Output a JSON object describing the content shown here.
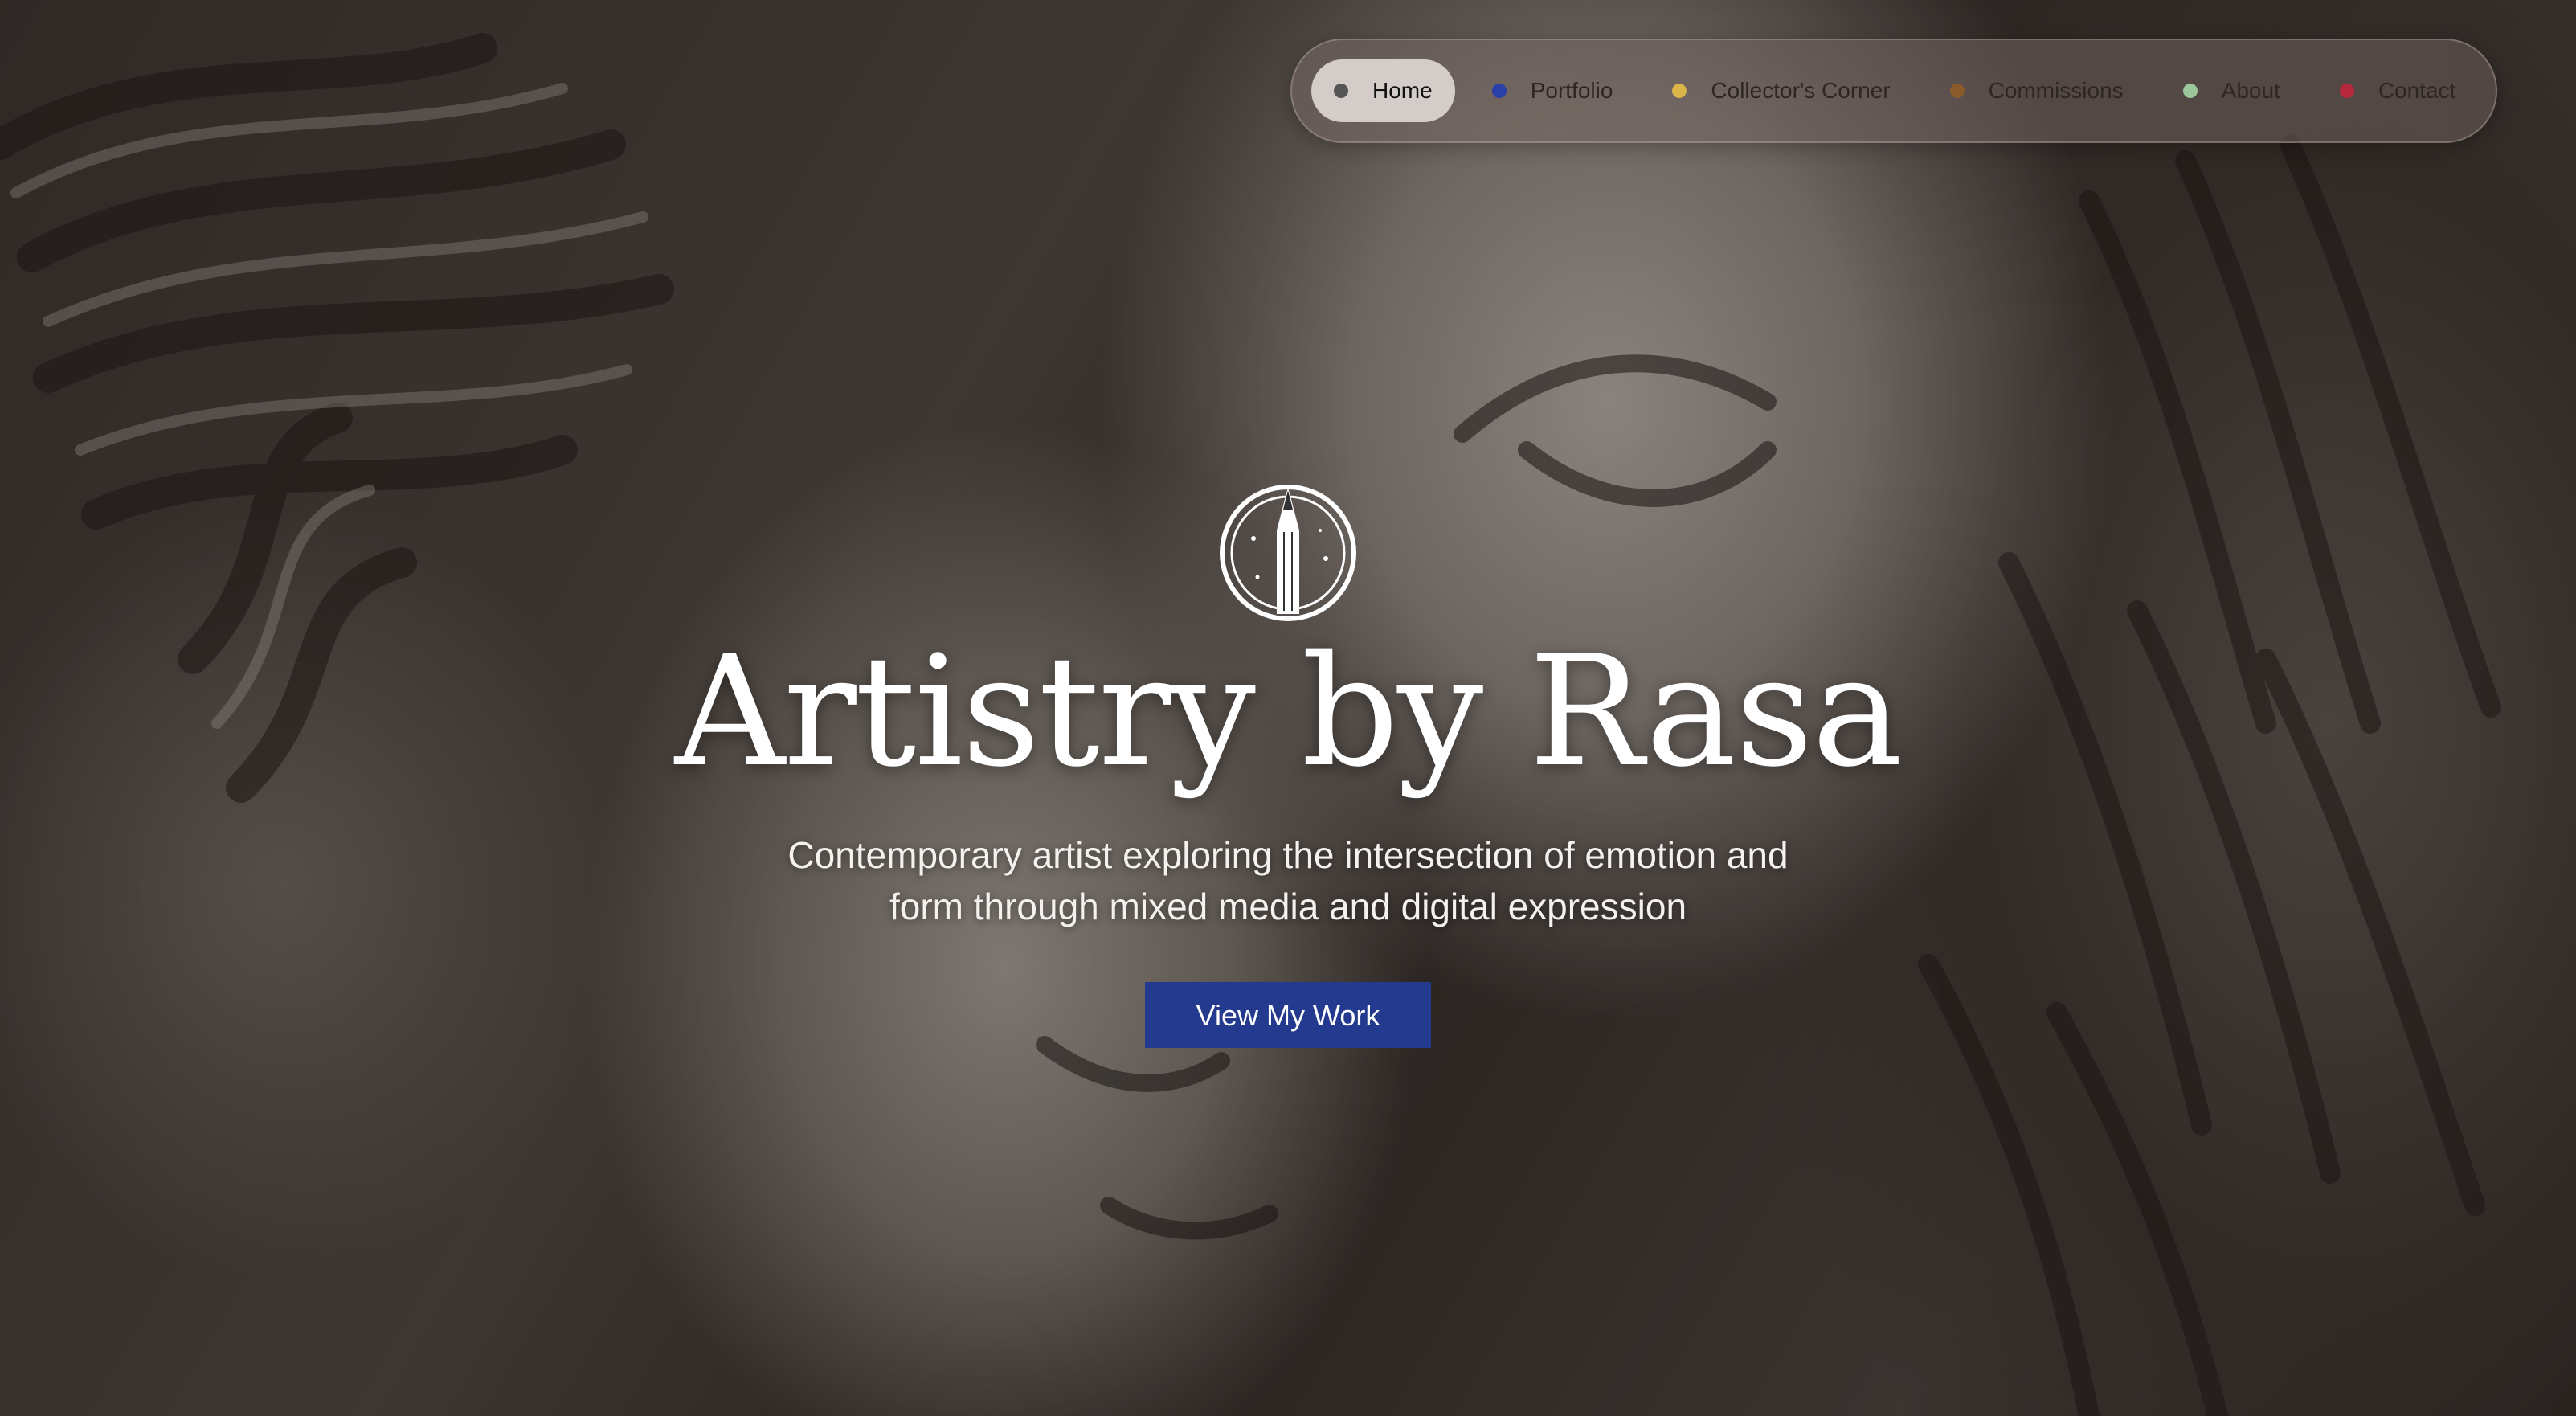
{
  "nav": {
    "items": [
      {
        "label": "Home",
        "dot_color": "#555555",
        "active": true
      },
      {
        "label": "Portfolio",
        "dot_color": "#2a3fa8",
        "active": false
      },
      {
        "label": "Collector's Corner",
        "dot_color": "#d9b54a",
        "active": false
      },
      {
        "label": "Commissions",
        "dot_color": "#8a5a2a",
        "active": false
      },
      {
        "label": "About",
        "dot_color": "#9cc79a",
        "active": false
      },
      {
        "label": "Contact",
        "dot_color": "#b8283c",
        "active": false
      }
    ]
  },
  "hero": {
    "logo_icon": "pencil-emblem-icon",
    "title": "Artistry by Rasa",
    "subtitle": "Contemporary artist exploring the intersection of emotion and form through mixed media and digital expression",
    "cta_label": "View My Work",
    "cta_color": "#243a8f",
    "background_image": "charcoal drawing of two angel faces with wings"
  }
}
